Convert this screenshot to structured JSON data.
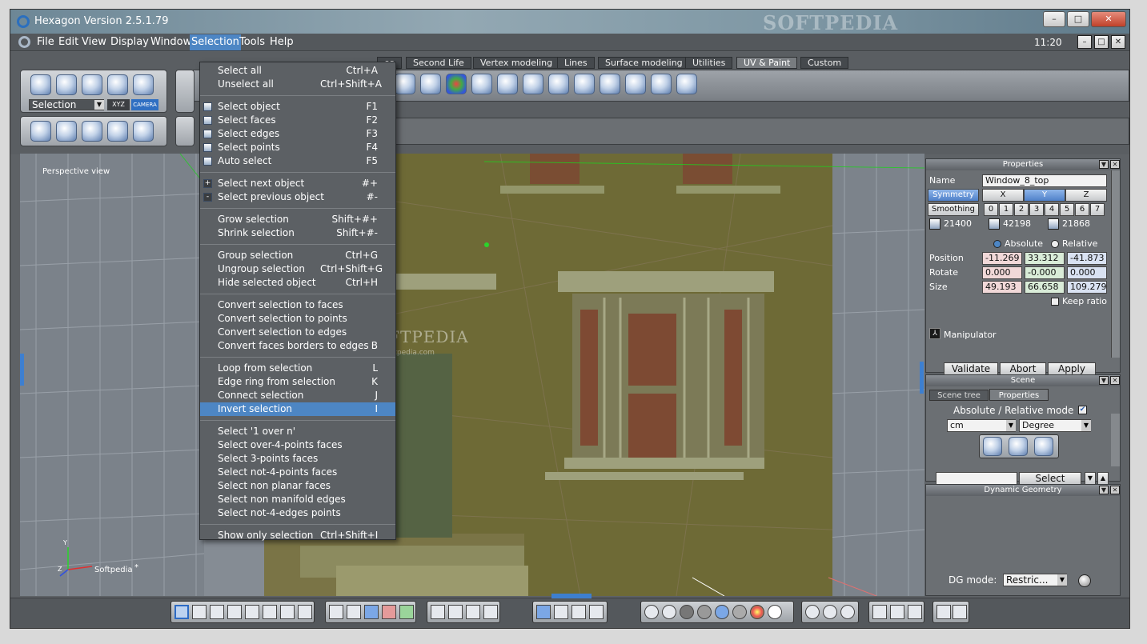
{
  "app": {
    "title": "Hexagon Version 2.5.1.79",
    "clock": "11:20",
    "title_buttons": [
      "–",
      "□",
      "✕"
    ],
    "mdi_buttons": [
      "–",
      "□",
      "✕"
    ]
  },
  "menubar": [
    "File",
    "Edit",
    "View",
    "Display",
    "Window",
    "Selection",
    "Tools",
    "Help"
  ],
  "tabs": [
    "es",
    "Second Life",
    "Vertex modeling",
    "Lines",
    "Surface modeling",
    "Utilities",
    "UV & Paint",
    "Custom"
  ],
  "active_tab": "UV & Paint",
  "toolbox": {
    "mode_value": "Selection",
    "xyz_label": "XYZ",
    "camera_label": "CAMERA"
  },
  "viewport": {
    "label": "Perspective view",
    "watermark": "SOFTPEDIA",
    "watermark_url": "www.softpedia.com",
    "axis_label": "Softpedia",
    "axis_star": "*",
    "axis_y": "Y",
    "axis_z": "Z"
  },
  "selection_menu": {
    "groups": [
      [
        {
          "label": "Select all",
          "key": "Ctrl+A"
        },
        {
          "label": "Unselect all",
          "key": "Ctrl+Shift+A"
        }
      ],
      [
        {
          "label": "Select object",
          "key": "F1",
          "icon": "cube-icon"
        },
        {
          "label": "Select faces",
          "key": "F2",
          "icon": "cube-icon"
        },
        {
          "label": "Select edges",
          "key": "F3",
          "icon": "cube-icon"
        },
        {
          "label": "Select points",
          "key": "F4",
          "icon": "cube-icon"
        },
        {
          "label": "Auto select",
          "key": "F5",
          "icon": "cube-icon"
        }
      ],
      [
        {
          "label": "Select next object",
          "key": "#+",
          "icon": "plus-icon"
        },
        {
          "label": "Select previous object",
          "key": "#-",
          "icon": "minus-icon"
        }
      ],
      [
        {
          "label": "Grow selection",
          "key": "Shift+#+"
        },
        {
          "label": "Shrink selection",
          "key": "Shift+#-"
        }
      ],
      [
        {
          "label": "Group selection",
          "key": "Ctrl+G"
        },
        {
          "label": "Ungroup selection",
          "key": "Ctrl+Shift+G"
        },
        {
          "label": "Hide selected object",
          "key": "Ctrl+H"
        }
      ],
      [
        {
          "label": "Convert selection to faces",
          "key": ""
        },
        {
          "label": "Convert selection to points",
          "key": ""
        },
        {
          "label": "Convert selection to edges",
          "key": ""
        },
        {
          "label": "Convert faces borders to edges",
          "key": "B"
        }
      ],
      [
        {
          "label": "Loop from selection",
          "key": "L"
        },
        {
          "label": "Edge ring from selection",
          "key": "K"
        },
        {
          "label": "Connect selection",
          "key": "J"
        },
        {
          "label": "Invert selection",
          "key": "I",
          "selected": true
        }
      ],
      [
        {
          "label": "Select '1 over n'",
          "key": ""
        },
        {
          "label": "Select over-4-points faces",
          "key": ""
        },
        {
          "label": "Select 3-points faces",
          "key": ""
        },
        {
          "label": "Select not-4-points faces",
          "key": ""
        },
        {
          "label": "Select non planar faces",
          "key": ""
        },
        {
          "label": "Select non manifold edges",
          "key": ""
        },
        {
          "label": "Select not-4-edges points",
          "key": ""
        }
      ],
      [
        {
          "label": "Show only selection",
          "key": "Ctrl+Shift+I"
        }
      ]
    ]
  },
  "properties": {
    "header": "Properties",
    "name_label": "Name",
    "name_value": "Window_8_top",
    "symmetry_label": "Symmetry",
    "sym_axes": [
      "X",
      "Y",
      "Z"
    ],
    "sym_active": "Y",
    "smoothing_label": "Smoothing",
    "smoothing_levels": [
      "0",
      "1",
      "2",
      "3",
      "4",
      "5",
      "6",
      "7"
    ],
    "counts": [
      "21400",
      "42198",
      "21868"
    ],
    "absolute_label": "Absolute",
    "relative_label": "Relative",
    "position_label": "Position",
    "rotate_label": "Rotate",
    "size_label": "Size",
    "position": [
      "-11.269",
      "33.312",
      "-41.873"
    ],
    "rotate": [
      "0.000",
      "-0.000",
      "0.000"
    ],
    "size": [
      "49.193",
      "66.658",
      "109.279"
    ],
    "keep_ratio_label": "Keep ratio",
    "manipulator_label": "Manipulator",
    "validate_label": "Validate",
    "abort_label": "Abort",
    "apply_label": "Apply"
  },
  "scene": {
    "header": "Scene",
    "tabs": [
      "Scene tree",
      "Properties"
    ],
    "mode_label": "Absolute / Relative mode",
    "unit_value": "cm",
    "angle_value": "Degree",
    "select_label": "Select",
    "search_value": ""
  },
  "dynamic_geometry": {
    "header": "Dynamic Geometry",
    "dg_mode_label": "DG mode:",
    "dg_mode_value": "Restric..."
  },
  "colors": {
    "accent": "#4d86c4",
    "panel": "#6b6f73",
    "wall": "#6e6a36"
  }
}
